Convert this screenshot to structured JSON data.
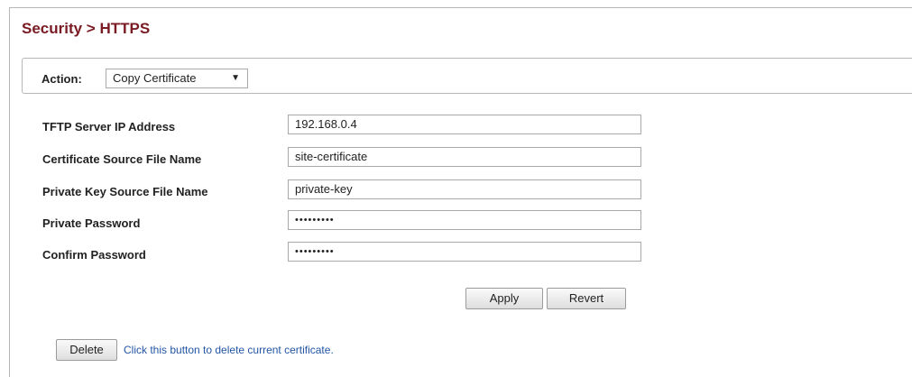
{
  "page": {
    "title": "Security > HTTPS"
  },
  "action": {
    "label": "Action:",
    "selected": "Copy Certificate"
  },
  "form": {
    "fields": [
      {
        "label": "TFTP Server IP Address",
        "value": "192.168.0.4"
      },
      {
        "label": "Certificate Source File Name",
        "value": "site-certificate"
      },
      {
        "label": "Private Key Source File Name",
        "value": "private-key"
      },
      {
        "label": "Private Password",
        "value": "•••••••••"
      },
      {
        "label": "Confirm Password",
        "value": "•••••••••"
      }
    ]
  },
  "buttons": {
    "apply": "Apply",
    "revert": "Revert",
    "delete": "Delete"
  },
  "delete_hint": "Click this button to delete current certificate."
}
